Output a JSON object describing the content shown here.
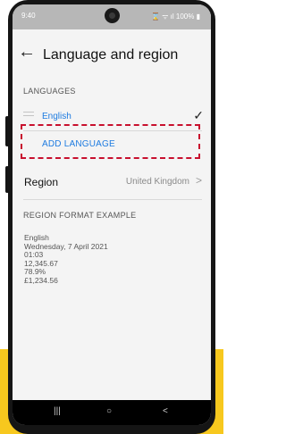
{
  "status_bar": {
    "time": "9:40",
    "indicators": "⌛ ᯤ ıl 100% ▮"
  },
  "header": {
    "back_icon": "←",
    "title": "Language and region"
  },
  "languages": {
    "section_title": "LANGUAGES",
    "items": [
      {
        "name": "English",
        "selected": true
      }
    ],
    "check_icon": "✓",
    "add_language_label": "ADD LANGUAGE"
  },
  "region": {
    "label": "Region",
    "value": "United Kingdom",
    "chevron": ">"
  },
  "format_example": {
    "section_title": "REGION FORMAT EXAMPLE",
    "lines": [
      "English",
      "Wednesday, 7 April 2021",
      "01:03",
      "12,345.67",
      "78.9%",
      "£1,234.56"
    ]
  },
  "nav_bar": {
    "recents": "|||",
    "home": "○",
    "back": "<"
  },
  "colors": {
    "accent": "#1e7be0",
    "highlight": "#c8102e",
    "band": "#f7c81e"
  }
}
